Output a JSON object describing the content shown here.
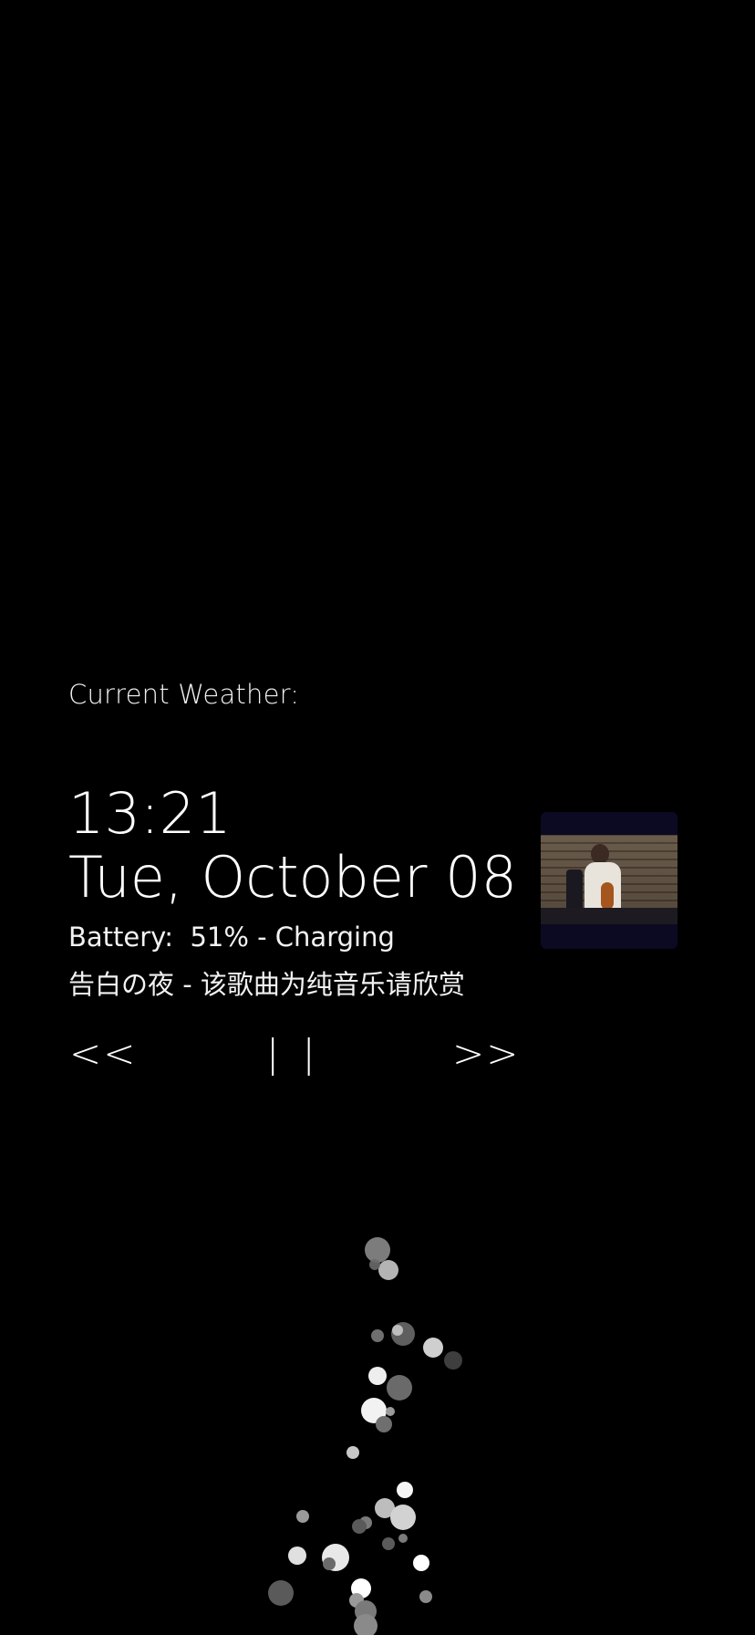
{
  "weather": {
    "label": "Current Weather:"
  },
  "clock": {
    "time": "13:21",
    "date": "Tue, October 08"
  },
  "battery": {
    "label": "Battery:",
    "value": "51% - Charging"
  },
  "media": {
    "now_playing": "告白の夜 - 该歌曲为纯音乐请欣赏",
    "controls": {
      "prev_label": "<<",
      "pause_label": "| |",
      "next_label": ">>"
    }
  },
  "colors": {
    "background": "#000000",
    "text": "#ffffff",
    "album_frame": "#0c0a22"
  },
  "icons": {
    "album_art": "album-art-icon"
  }
}
